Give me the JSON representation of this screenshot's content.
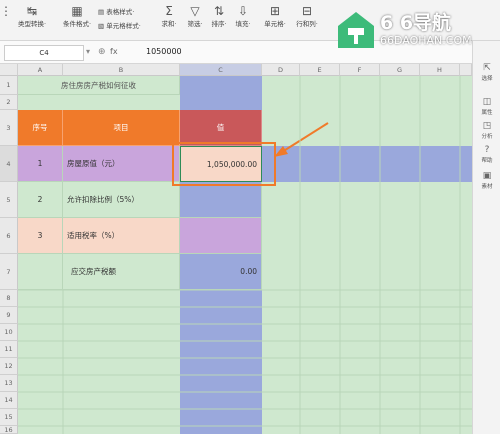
{
  "ribbon": {
    "items": [
      {
        "icon": "↹",
        "label": "类型转换·"
      },
      {
        "icon": "▦",
        "label": "条件格式·"
      },
      {
        "icon": "▤",
        "label": "表格样式·"
      },
      {
        "icon": "▧",
        "label": "单元格样式·"
      },
      {
        "icon": "Σ",
        "label": "求和·"
      },
      {
        "icon": "▽",
        "label": "筛选·"
      },
      {
        "icon": "⇅",
        "label": "排序·"
      },
      {
        "icon": "⇩",
        "label": "填充·"
      },
      {
        "icon": "⊞",
        "label": "单元格·"
      },
      {
        "icon": "⊟",
        "label": "行和列·"
      }
    ]
  },
  "formula": {
    "cell_ref": "C4",
    "fx": "fx",
    "value": "1050000"
  },
  "columns": [
    "A",
    "B",
    "C",
    "D",
    "E",
    "F",
    "G",
    "H"
  ],
  "rows": [
    "1",
    "2",
    "3",
    "4",
    "5",
    "6",
    "7",
    "8",
    "9",
    "10",
    "11",
    "12",
    "13",
    "14",
    "15",
    "16"
  ],
  "sheet": {
    "title": "房住房房产税如何征收",
    "header_no": "序号",
    "header_item": "项目",
    "header_value": "值",
    "r4": {
      "no": "1",
      "item": "房屋原值（元）",
      "value": "1,050,000.00"
    },
    "r5": {
      "no": "2",
      "item": "允许扣除比例（5%）",
      "value": ""
    },
    "r6": {
      "no": "3",
      "item": "适用税率（%）",
      "value": ""
    },
    "r7": {
      "no": "",
      "item": "应交房产税额",
      "value": "0.00"
    }
  },
  "sidebar": {
    "items": [
      {
        "icon": "⇱",
        "label": "选择"
      },
      {
        "icon": "◫",
        "label": "属性"
      },
      {
        "icon": "◳",
        "label": "分析"
      },
      {
        "icon": "?",
        "label": "帮助"
      },
      {
        "icon": "▣",
        "label": "素材"
      }
    ]
  },
  "watermark": {
    "brand": "6 6导航",
    "url": "66DAOHAN.COM"
  },
  "colors": {
    "orange": "#f07a2a",
    "red": "#c9585a",
    "purple": "#c9a5dc",
    "blue": "#9aa8dc",
    "green": "#cfe8cf",
    "peach": "#f8d8c8"
  }
}
